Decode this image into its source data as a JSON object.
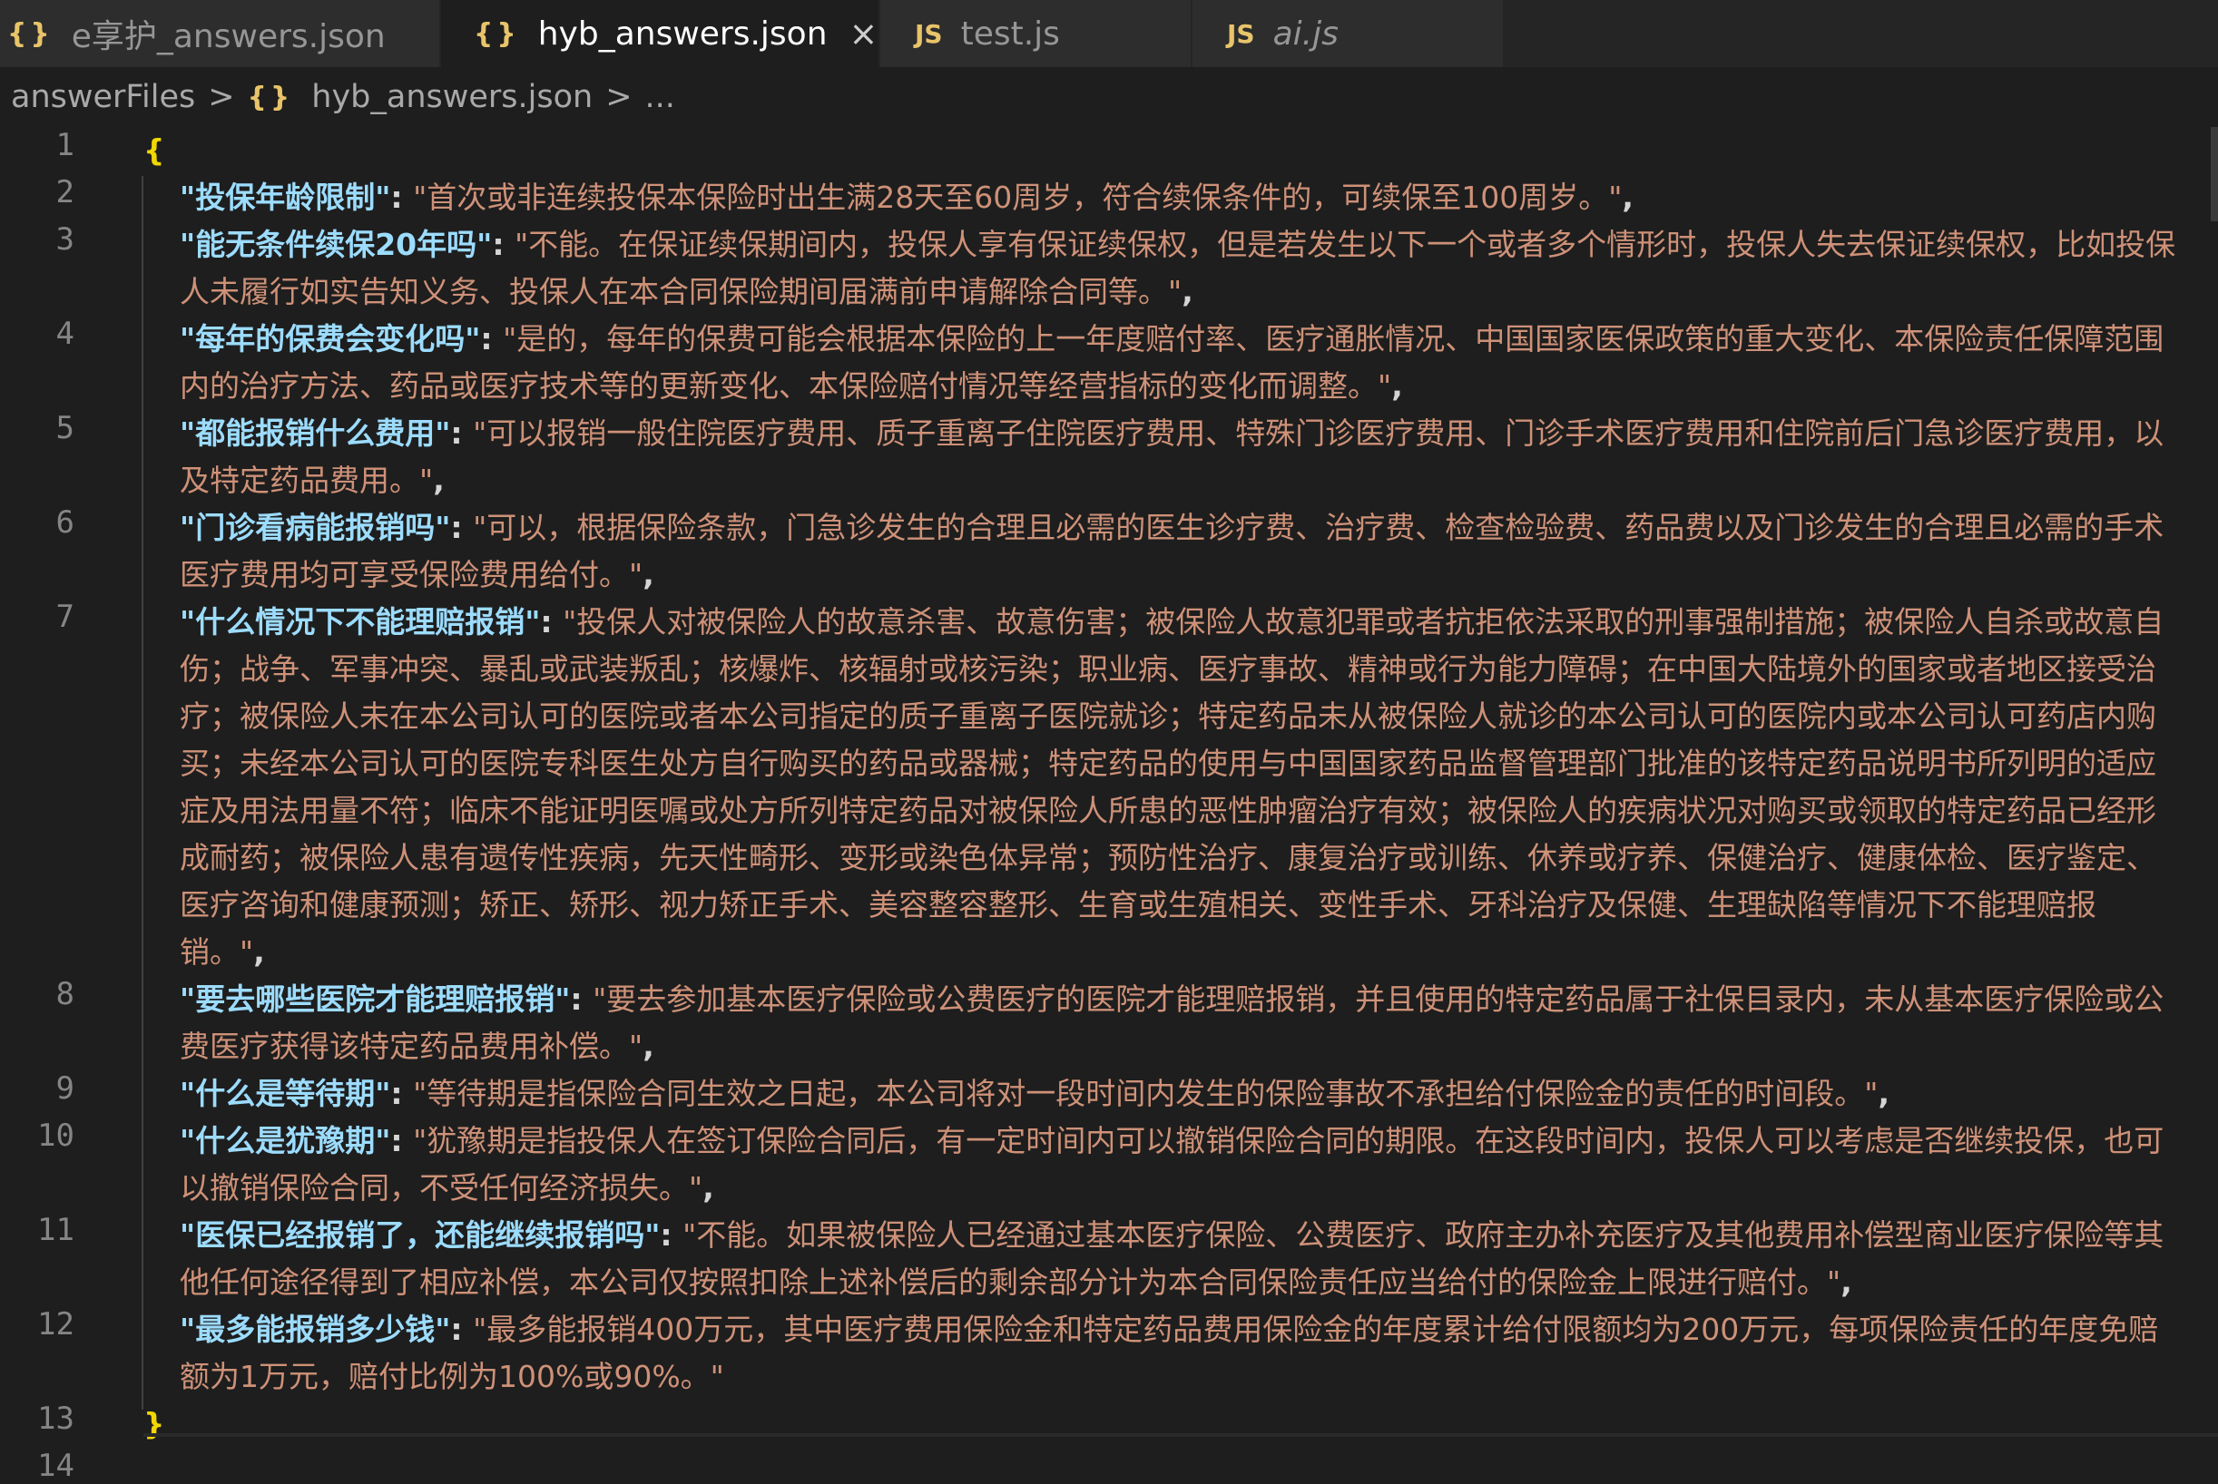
{
  "tabs": [
    {
      "label": "e享护_answers.json",
      "icon": "{}",
      "active": false
    },
    {
      "label": "hyb_answers.json",
      "icon": "{}",
      "active": true,
      "close": "×"
    },
    {
      "label": "test.js",
      "icon": "JS",
      "active": false
    },
    {
      "label": "ai.js",
      "icon": "JS",
      "active": false
    }
  ],
  "breadcrumb": {
    "folder": "answerFiles",
    "sep": ">",
    "file_icon": "{}",
    "file": "hyb_answers.json",
    "more": "..."
  },
  "editor": {
    "open_brace": "{",
    "close_brace": "}",
    "line_numbers": [
      "1",
      "2",
      "3",
      "4",
      "5",
      "6",
      "7",
      "8",
      "9",
      "10",
      "11",
      "12",
      "13",
      "14"
    ],
    "colon": ": ",
    "comma": ",",
    "entries": [
      {
        "key": "\"投保年龄限制\"",
        "value": "\"首次或非连续投保本保险时出生满28天至60周岁，符合续保条件的，可续保至100周岁。\""
      },
      {
        "key": "\"能无条件续保20年吗\"",
        "value": "\"不能。在保证续保期间内，投保人享有保证续保权，但是若发生以下一个或者多个情形时，投保人失去保证续保权，比如投保人未履行如实告知义务、投保人在本合同保险期间届满前申请解除合同等。\""
      },
      {
        "key": "\"每年的保费会变化吗\"",
        "value": "\"是的，每年的保费可能会根据本保险的上一年度赔付率、医疗通胀情况、中国国家医保政策的重大变化、本保险责任保障范围内的治疗方法、药品或医疗技术等的更新变化、本保险赔付情况等经营指标的变化而调整。\""
      },
      {
        "key": "\"都能报销什么费用\"",
        "value": "\"可以报销一般住院医疗费用、质子重离子住院医疗费用、特殊门诊医疗费用、门诊手术医疗费用和住院前后门急诊医疗费用，以及特定药品费用。\""
      },
      {
        "key": "\"门诊看病能报销吗\"",
        "value": "\"可以，根据保险条款，门急诊发生的合理且必需的医生诊疗费、治疗费、检查检验费、药品费以及门诊发生的合理且必需的手术医疗费用均可享受保险费用给付。\""
      },
      {
        "key": "\"什么情况下不能理赔报销\"",
        "value": "\"投保人对被保险人的故意杀害、故意伤害；被保险人故意犯罪或者抗拒依法采取的刑事强制措施；被保险人自杀或故意自伤；战争、军事冲突、暴乱或武装叛乱；核爆炸、核辐射或核污染；职业病、医疗事故、精神或行为能力障碍；在中国大陆境外的国家或者地区接受治疗；被保险人未在本公司认可的医院或者本公司指定的质子重离子医院就诊；特定药品未从被保险人就诊的本公司认可的医院内或本公司认可药店内购买；未经本公司认可的医院专科医生处方自行购买的药品或器械；特定药品的使用与中国国家药品监督管理部门批准的该特定药品说明书所列明的适应症及用法用量不符；临床不能证明医嘱或处方所列特定药品对被保险人所患的恶性肿瘤治疗有效；被保险人的疾病状况对购买或领取的特定药品已经形成耐药；被保险人患有遗传性疾病，先天性畸形、变形或染色体异常；预防性治疗、康复治疗或训练、休养或疗养、保健治疗、健康体检、医疗鉴定、医疗咨询和健康预测；矫正、矫形、视力矫正手术、美容整容整形、生育或生殖相关、变性手术、牙科治疗及保健、生理缺陷等情况下不能理赔报销。\""
      },
      {
        "key": "\"要去哪些医院才能理赔报销\"",
        "value": "\"要去参加基本医疗保险或公费医疗的医院才能理赔报销，并且使用的特定药品属于社保目录内，未从基本医疗保险或公费医疗获得该特定药品费用补偿。\""
      },
      {
        "key": "\"什么是等待期\"",
        "value": "\"等待期是指保险合同生效之日起，本公司将对一段时间内发生的保险事故不承担给付保险金的责任的时间段。\""
      },
      {
        "key": "\"什么是犹豫期\"",
        "value": "\"犹豫期是指投保人在签订保险合同后，有一定时间内可以撤销保险合同的期限。在这段时间内，投保人可以考虑是否继续投保，也可以撤销保险合同，不受任何经济损失。\""
      },
      {
        "key": "\"医保已经报销了，还能继续报销吗\"",
        "value": "\"不能。如果被保险人已经通过基本医疗保险、公费医疗、政府主办补充医疗及其他费用补偿型商业医疗保险等其他任何途径得到了相应补偿，本公司仅按照扣除上述补偿后的剩余部分计为本合同保险责任应当给付的保险金上限进行赔付。\""
      },
      {
        "key": "\"最多能报销多少钱\"",
        "value": "\"最多能报销400万元，其中医疗费用保险金和特定药品费用保险金的年度累计给付限额均为200万元，每项保险责任的年度免赔额为1万元，赔付比例为100%或90%。\""
      }
    ]
  }
}
